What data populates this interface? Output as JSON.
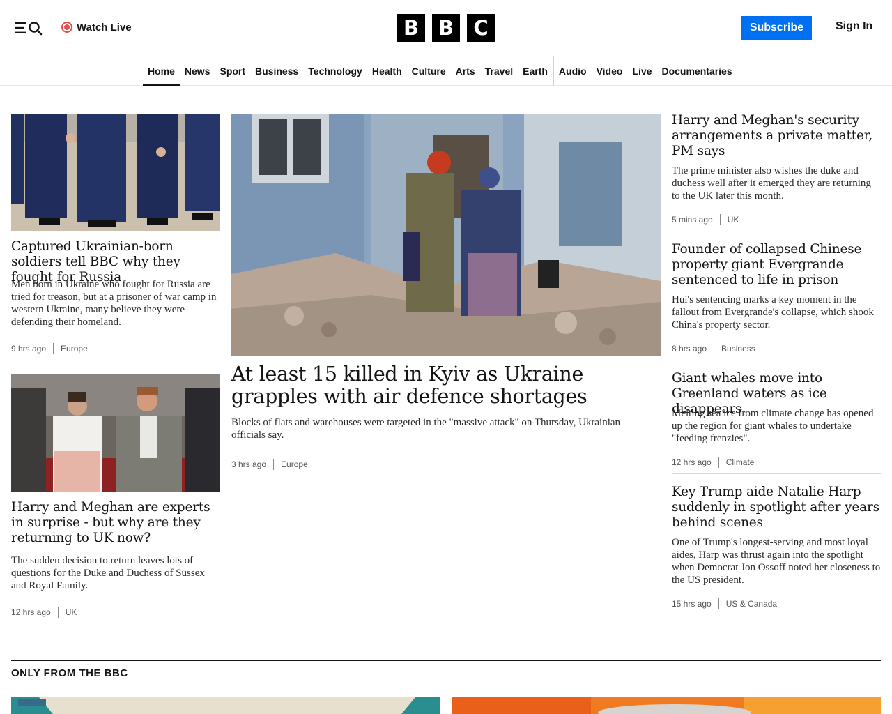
{
  "header": {
    "watch_live": "Watch Live",
    "logo_letters": [
      "B",
      "B",
      "C"
    ],
    "subscribe": "Subscribe",
    "sign_in": "Sign In"
  },
  "nav": [
    "Home",
    "News",
    "Sport",
    "Business",
    "Technology",
    "Health",
    "Culture",
    "Arts",
    "Travel",
    "Earth",
    "Audio",
    "Video",
    "Live",
    "Documentaries"
  ],
  "colors": {
    "accent": "#0070f3",
    "live": "#e84e4e",
    "text": "#141414",
    "meta": "#545658"
  },
  "left": [
    {
      "headline": "Captured Ukrainian-born soldiers tell BBC why they fought for Russia",
      "summary": "Men born in Ukraine who fought for Russia are tried for treason, but at a prisoner of war camp in western Ukraine, many believe they were defending their homeland.",
      "time": "9 hrs ago",
      "category": "Europe"
    },
    {
      "headline": "Harry and Meghan are experts in surprise - but why are they returning to UK now?",
      "summary": "The sudden decision to return leaves lots of questions for the Duke and Duchess of Sussex and Royal Family.",
      "time": "12 hrs ago",
      "category": "UK"
    }
  ],
  "main": {
    "headline": "At least 15 killed in Kyiv as Ukraine grapples with air defence shortages",
    "summary": "Blocks of flats and warehouses were targeted in the \"massive attack\" on Thursday, Ukrainian officials say.",
    "time": "3 hrs ago",
    "category": "Europe"
  },
  "right": [
    {
      "headline": "Harry and Meghan's security arrangements a private matter, PM says",
      "summary": "The prime minister also wishes the duke and duchess well after it emerged they are returning to the UK later this month.",
      "time": "5 mins ago",
      "category": "UK"
    },
    {
      "headline": "Founder of collapsed Chinese property giant Evergrande sentenced to life in prison",
      "summary": "Hui's sentencing marks a key moment in the fallout from Evergrande's collapse, which shook China's property sector.",
      "time": "8 hrs ago",
      "category": "Business"
    },
    {
      "headline": "Giant whales move into Greenland waters as ice disappears",
      "summary": "Melting sea ice from climate change has opened up the region for giant whales to undertake \"feeding frenzies\".",
      "time": "12 hrs ago",
      "category": "Climate"
    },
    {
      "headline": "Key Trump aide Natalie Harp suddenly in spotlight after years behind scenes",
      "summary": "One of Trump's longest-serving and most loyal aides, Harp was thrust again into the spotlight when Democrat Jon Ossoff noted her closeness to the US president.",
      "time": "15 hrs ago",
      "category": "US & Canada"
    }
  ],
  "section": {
    "title": "ONLY FROM THE BBC"
  }
}
